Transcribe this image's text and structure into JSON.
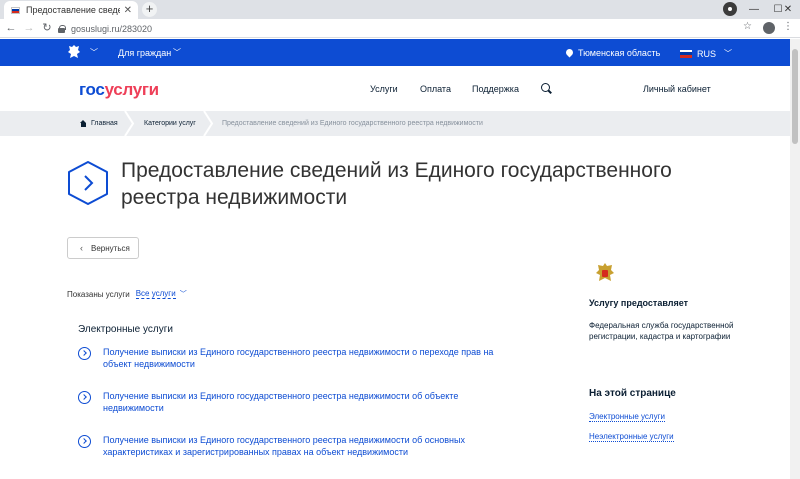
{
  "browser": {
    "tab_title": "Предоставление сведений из Е",
    "tab_close": "✕",
    "new_tab": "+",
    "url": "gosuslugi.ru/283020",
    "minimize": "—",
    "maximize": "☐",
    "close": "✕"
  },
  "topbar": {
    "for_citizens": "Для граждан",
    "region": "Тюменская область",
    "language": "RUS"
  },
  "header": {
    "logo_part1": "гос",
    "logo_part2": "услуги",
    "nav": [
      "Услуги",
      "Оплата",
      "Поддержка"
    ],
    "cabinet": "Личный кабинет"
  },
  "breadcrumbs": [
    "Главная",
    "Категории услуг",
    "Предоставление сведений из Единого государственного реестра недвижимости"
  ],
  "page": {
    "title": "Предоставление сведений из Единого государственного реестра недвижимости",
    "back_label": "Вернуться",
    "shown_label": "Показаны услуги",
    "shown_value": "Все услуги",
    "section_title": "Электронные услуги",
    "services": [
      "Получение выписки из Единого государственного реестра недвижимости о переходе прав на объект недвижимости",
      "Получение выписки из Единого государственного реестра недвижимости об объекте недвижимости",
      "Получение выписки из Единого государственного реестра недвижимости об основных характеристиках и зарегистрированных правах на объект недвижимости"
    ]
  },
  "sidebar": {
    "provider_title": "Услугу предоставляет",
    "provider_name": "Федеральная служба государственной регистрации, кадастра и картографии",
    "onpage_title": "На этой странице",
    "onpage_links": [
      "Электронные услуги",
      "Неэлектронные услуги"
    ]
  },
  "colors": {
    "brand_blue": "#0d4cd3",
    "brand_red": "#ee3f58",
    "breadcrumb_bg": "#ebedf0"
  }
}
